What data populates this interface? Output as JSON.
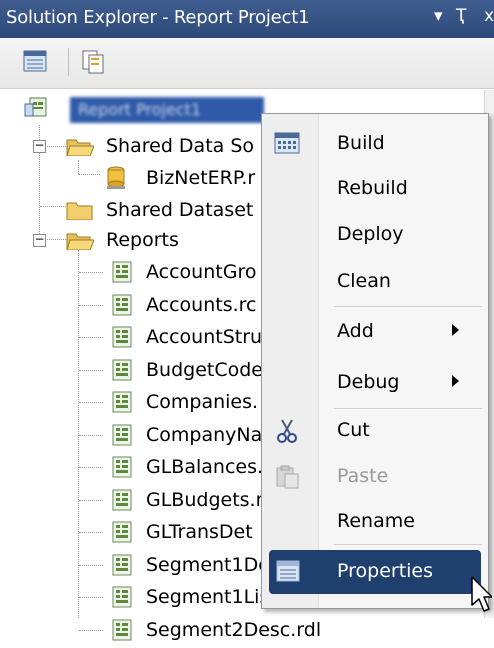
{
  "window": {
    "title": "Solution Explorer - Report Project1",
    "pin_glyph": "▾",
    "autohide_glyph": "Ҭ",
    "close_glyph": "x"
  },
  "toolbar": {
    "buttons": [
      {
        "icon": "properties-icon"
      },
      {
        "icon": "show-all-files-icon"
      }
    ]
  },
  "tree": {
    "root": {
      "label": "Report Project1",
      "icon": "report-project-icon"
    },
    "shared_data_sources": {
      "label": "Shared Data So",
      "expanded": true,
      "children": [
        "BizNetERP.r"
      ]
    },
    "shared_datasets": {
      "label": "Shared Dataset"
    },
    "reports": {
      "label": "Reports",
      "expanded": true,
      "children": [
        "AccountGro",
        "Accounts.rc",
        "AccountStru",
        "BudgetCode",
        "Companies.",
        "CompanyNa",
        "GLBalances.",
        "GLBudgets.r",
        "GLTransDet",
        "Segment1De",
        "Segment1Lis",
        "Segment2Desc.rdl"
      ]
    }
  },
  "context_menu": {
    "items": [
      {
        "label": "Build",
        "icon": "build-icon"
      },
      {
        "label": "Rebuild"
      },
      {
        "label": "Deploy"
      },
      {
        "label": "Clean"
      },
      {
        "label": "Add",
        "submenu": true
      },
      {
        "label": "Debug",
        "submenu": true
      },
      {
        "label": "Cut",
        "icon": "scissors-icon"
      },
      {
        "label": "Paste",
        "icon": "paste-icon",
        "disabled": true
      },
      {
        "label": "Rename"
      },
      {
        "label": "Properties",
        "icon": "properties-icon",
        "highlighted": true
      }
    ]
  },
  "colors": {
    "title_bar": "#2d4a7a",
    "selection": "#2f5aa8",
    "menu_highlight": "#1f3f6f"
  }
}
